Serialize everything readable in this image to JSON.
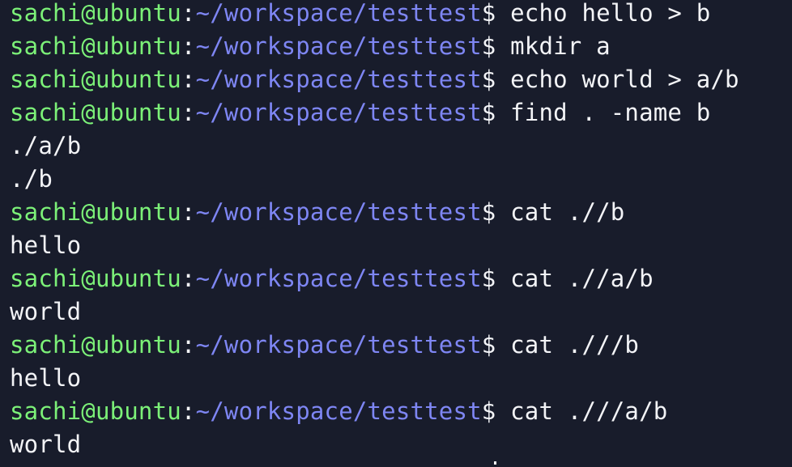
{
  "prompt": {
    "user_host": "sachi@ubuntu",
    "separator": ":",
    "path": "~/workspace/testtest",
    "symbol": "$"
  },
  "lines": [
    {
      "type": "command",
      "command": "echo hello > b"
    },
    {
      "type": "command",
      "command": "mkdir a"
    },
    {
      "type": "command",
      "command": "echo world > a/b"
    },
    {
      "type": "command",
      "command": "find . -name b"
    },
    {
      "type": "output",
      "text": "./a/b"
    },
    {
      "type": "output",
      "text": "./b"
    },
    {
      "type": "command",
      "command": "cat .//b"
    },
    {
      "type": "output",
      "text": "hello"
    },
    {
      "type": "command",
      "command": "cat .//a/b"
    },
    {
      "type": "output",
      "text": "world"
    },
    {
      "type": "command",
      "command": "cat .///b"
    },
    {
      "type": "output",
      "text": "hello"
    },
    {
      "type": "command",
      "command": "cat .///a/b"
    },
    {
      "type": "output",
      "text": "world"
    }
  ],
  "colors": {
    "background": "#181c2b",
    "user_host": "#7cf178",
    "path": "#7e86f3",
    "text": "#f3f4f7"
  }
}
